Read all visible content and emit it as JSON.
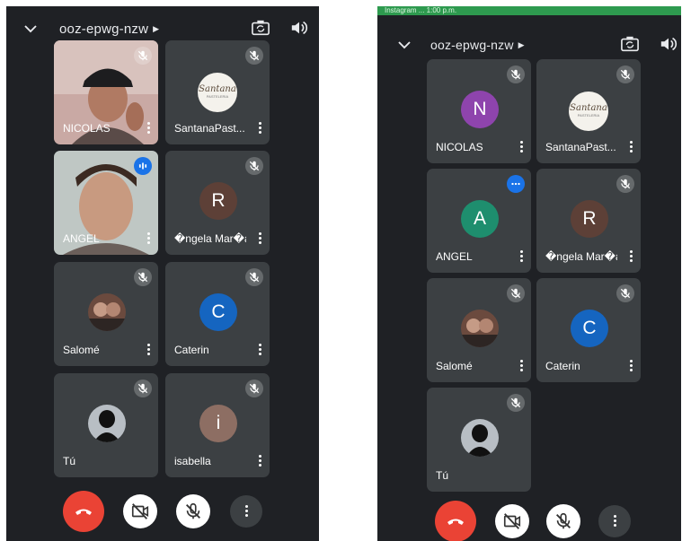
{
  "left_screen": {
    "meeting_code": "ooz-epwg-nzw",
    "tiles": [
      {
        "name": "NICOLAS",
        "type": "video",
        "muted": true
      },
      {
        "name": "SantanaPast...",
        "type": "logo",
        "muted": true
      },
      {
        "name": "ANGEL",
        "type": "video",
        "muted": false,
        "speaking": true
      },
      {
        "name": "�ngela Mar�a",
        "type": "letter",
        "letter": "R",
        "color": "#5d4037",
        "muted": true
      },
      {
        "name": "Salomé",
        "type": "photo",
        "muted": true
      },
      {
        "name": "Caterin",
        "type": "letter",
        "letter": "C",
        "color": "#1565c0",
        "muted": true
      },
      {
        "name": "Tú",
        "type": "silhouette",
        "muted": true
      },
      {
        "name": "isabella",
        "type": "letter",
        "letter": "i",
        "color": "#8d6e63",
        "muted": true
      }
    ]
  },
  "right_screen": {
    "status_bar": "Instagram  ...  1:00 p.m.",
    "meeting_code": "ooz-epwg-nzw",
    "tiles": [
      {
        "name": "NICOLAS",
        "type": "letter",
        "letter": "N",
        "color": "#8e44ad",
        "muted": true
      },
      {
        "name": "SantanaPast...",
        "type": "logo",
        "muted": true
      },
      {
        "name": "ANGEL",
        "type": "letter",
        "letter": "A",
        "color": "#1e8e6e",
        "muted": false,
        "speaking": true
      },
      {
        "name": "�ngela Mar�a",
        "type": "letter",
        "letter": "R",
        "color": "#5d4037",
        "muted": true
      },
      {
        "name": "Salomé",
        "type": "photo",
        "muted": true
      },
      {
        "name": "Caterin",
        "type": "letter",
        "letter": "C",
        "color": "#1565c0",
        "muted": true
      },
      {
        "name": "Tú",
        "type": "silhouette",
        "muted": true
      }
    ]
  },
  "logo": {
    "script": "Santana",
    "tiny": "PASTELERIA"
  },
  "colors": {
    "end_call": "#ea4335",
    "panel_bg": "#1f2125",
    "tile_bg": "#3c4043",
    "speaking_badge": "#1a73e8"
  },
  "icons": {
    "collapse": "chevron-down-icon",
    "meeting_info": "caret-right-icon",
    "switch_camera": "camera-switch-icon",
    "audio_output": "speaker-icon",
    "mute_badge": "mic-off-icon",
    "speaking_badge": "audio-wave-icon",
    "end_call": "phone-hangup-icon",
    "camera_toggle": "video-off-icon",
    "mic_toggle": "mic-off-icon",
    "more": "more-vert-icon"
  }
}
